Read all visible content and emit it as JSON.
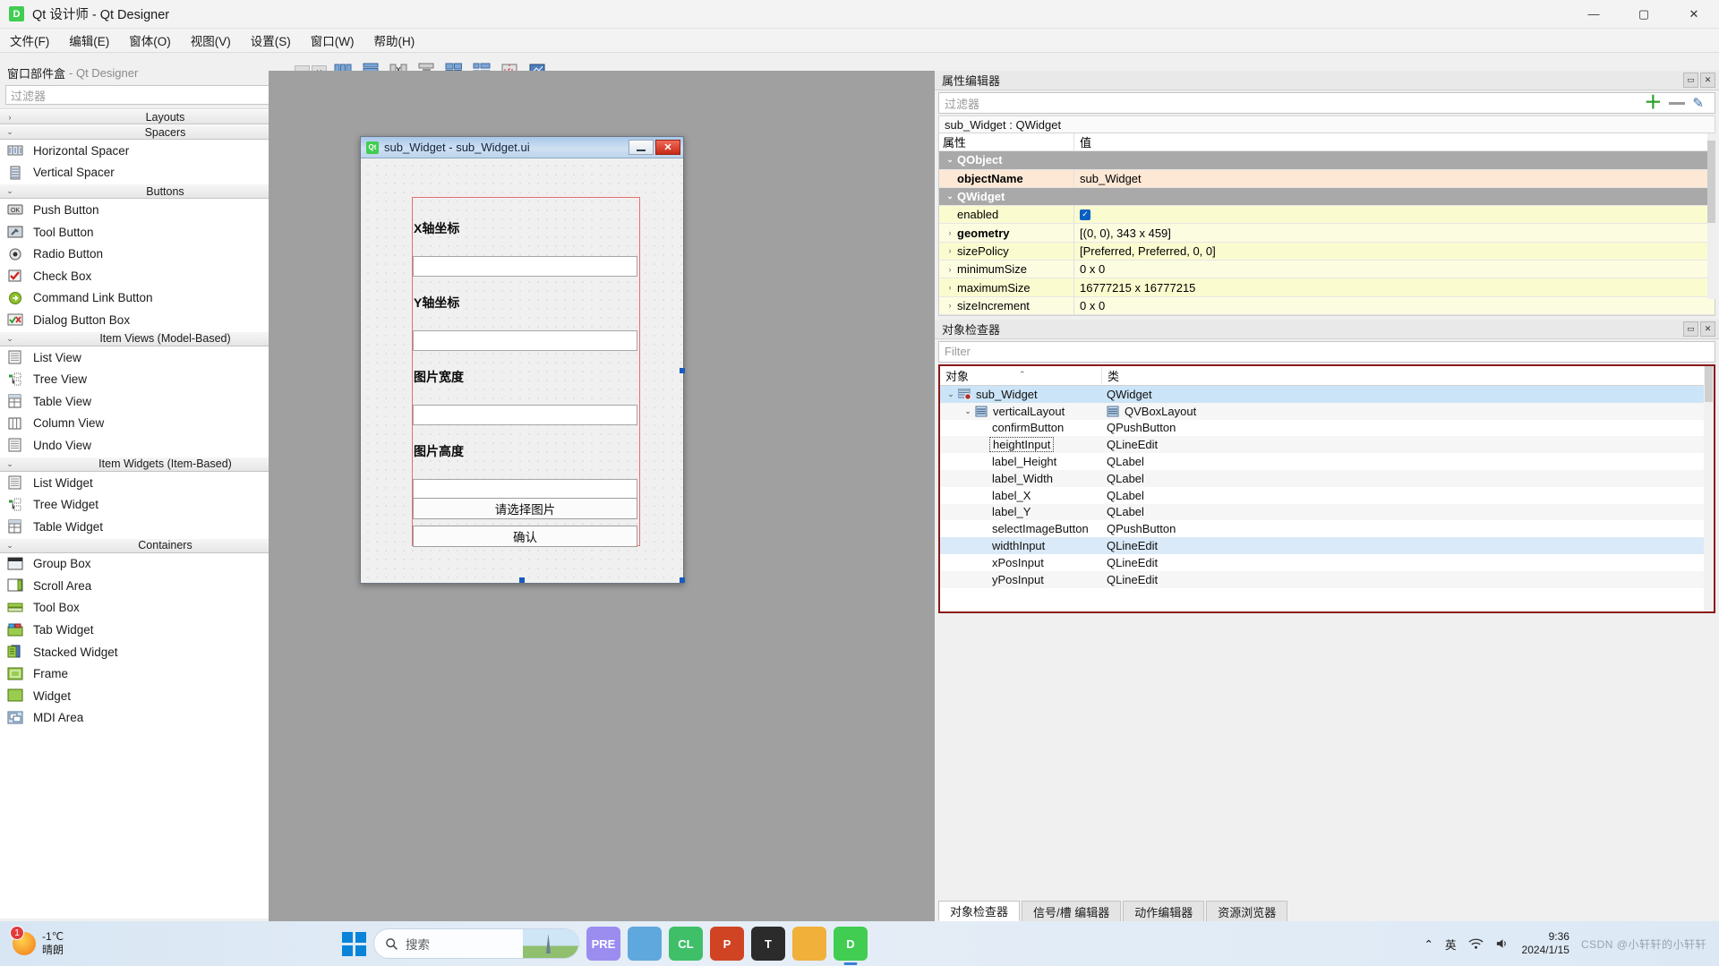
{
  "window": {
    "title": "Qt 设计师 - Qt Designer",
    "logo_text": "D",
    "minimize": "—",
    "maximize": "▢",
    "close": "✕"
  },
  "menubar": {
    "items": [
      "文件(F)",
      "编辑(E)",
      "窗体(O)",
      "视图(V)",
      "设置(S)",
      "窗口(W)",
      "帮助(H)"
    ]
  },
  "toolbar": {
    "icons": [
      "layout-horizontal-icon",
      "layout-vertical-icon",
      "layout-splitter-h-icon",
      "layout-splitter-v-icon",
      "layout-grid-icon",
      "layout-form-icon",
      "break-layout-icon",
      "adjust-size-icon"
    ]
  },
  "widgetbox": {
    "dock_title": "窗口部件盒",
    "dock_subtitle": "- Qt Designer",
    "dock_float": "▭",
    "dock_close": "✕",
    "filter_placeholder": "过滤器",
    "categories": [
      {
        "name": "Layouts",
        "expanded": false,
        "items": []
      },
      {
        "name": "Spacers",
        "expanded": true,
        "items": [
          {
            "label": "Horizontal Spacer",
            "icon": "horizontal-spacer-icon"
          },
          {
            "label": "Vertical Spacer",
            "icon": "vertical-spacer-icon"
          }
        ]
      },
      {
        "name": "Buttons",
        "expanded": true,
        "items": [
          {
            "label": "Push Button",
            "icon": "push-button-icon"
          },
          {
            "label": "Tool Button",
            "icon": "tool-button-icon"
          },
          {
            "label": "Radio Button",
            "icon": "radio-button-icon"
          },
          {
            "label": "Check Box",
            "icon": "check-box-icon"
          },
          {
            "label": "Command Link Button",
            "icon": "command-link-button-icon"
          },
          {
            "label": "Dialog Button Box",
            "icon": "dialog-button-box-icon"
          }
        ]
      },
      {
        "name": "Item Views (Model-Based)",
        "expanded": true,
        "items": [
          {
            "label": "List View",
            "icon": "list-view-icon"
          },
          {
            "label": "Tree View",
            "icon": "tree-view-icon"
          },
          {
            "label": "Table View",
            "icon": "table-view-icon"
          },
          {
            "label": "Column View",
            "icon": "column-view-icon"
          },
          {
            "label": "Undo View",
            "icon": "undo-view-icon"
          }
        ]
      },
      {
        "name": "Item Widgets (Item-Based)",
        "expanded": true,
        "items": [
          {
            "label": "List Widget",
            "icon": "list-widget-icon"
          },
          {
            "label": "Tree Widget",
            "icon": "tree-widget-icon"
          },
          {
            "label": "Table Widget",
            "icon": "table-widget-icon"
          }
        ]
      },
      {
        "name": "Containers",
        "expanded": true,
        "items": [
          {
            "label": "Group Box",
            "icon": "group-box-icon"
          },
          {
            "label": "Scroll Area",
            "icon": "scroll-area-icon"
          },
          {
            "label": "Tool Box",
            "icon": "tool-box-icon"
          },
          {
            "label": "Tab Widget",
            "icon": "tab-widget-icon"
          },
          {
            "label": "Stacked Widget",
            "icon": "stacked-widget-icon"
          },
          {
            "label": "Frame",
            "icon": "frame-icon"
          },
          {
            "label": "Widget",
            "icon": "widget-icon"
          },
          {
            "label": "MDI Area",
            "icon": "mdi-area-icon"
          }
        ]
      }
    ]
  },
  "form": {
    "title": "sub_Widget - sub_Widget.ui",
    "logo_text": "Qt",
    "minimize": "—",
    "close": "✕",
    "fields": [
      {
        "label": "X轴坐标",
        "input_value": ""
      },
      {
        "label": "Y轴坐标",
        "input_value": ""
      },
      {
        "label": "图片宽度",
        "input_value": ""
      },
      {
        "label": "图片高度",
        "input_value": ""
      }
    ],
    "buttons": [
      "请选择图片",
      "确认"
    ]
  },
  "property_editor": {
    "title": "属性编辑器",
    "float_btn": "▭",
    "close_btn": "✕",
    "filter_placeholder": "过滤器",
    "add_btn": "＋",
    "remove_btn": "▬",
    "config_btn": "🖉",
    "object_header": "sub_Widget : QWidget",
    "columns": [
      "属性",
      "值"
    ],
    "rows": [
      {
        "kind": "group",
        "name": "QObject",
        "value": "",
        "twisty": "⌄"
      },
      {
        "kind": "orange",
        "name": "objectName",
        "value": "sub_Widget",
        "bold": true,
        "twisty": ""
      },
      {
        "kind": "group",
        "name": "QWidget",
        "value": "",
        "twisty": "⌄"
      },
      {
        "kind": "yellow",
        "name": "enabled",
        "value": "checkbox",
        "twisty": ""
      },
      {
        "kind": "yellow2",
        "name": "geometry",
        "value": "[(0, 0), 343 x 459]",
        "bold": true,
        "twisty": "›"
      },
      {
        "kind": "yellow",
        "name": "sizePolicy",
        "value": "[Preferred, Preferred, 0, 0]",
        "twisty": "›"
      },
      {
        "kind": "yellow2",
        "name": "minimumSize",
        "value": "0 x 0",
        "twisty": "›"
      },
      {
        "kind": "yellow",
        "name": "maximumSize",
        "value": "16777215 x 16777215",
        "twisty": "›"
      },
      {
        "kind": "yellow2",
        "name": "sizeIncrement",
        "value": "0 x 0",
        "twisty": "›"
      }
    ]
  },
  "object_inspector": {
    "title": "对象检查器",
    "float_btn": "▭",
    "close_btn": "✕",
    "filter_placeholder": "Filter",
    "columns": [
      "对象",
      "类"
    ],
    "sort_arrow": "⌃",
    "rows": [
      {
        "name": "sub_Widget",
        "class": "QWidget",
        "indent": 0,
        "twisty": "⌄",
        "icon": "widget-icon",
        "selected": true,
        "class_icon": false
      },
      {
        "name": "verticalLayout",
        "class": "QVBoxLayout",
        "indent": 1,
        "twisty": "⌄",
        "icon": "layout-icon",
        "alt": true,
        "class_icon": true
      },
      {
        "name": "confirmButton",
        "class": "QPushButton",
        "indent": 2,
        "twisty": "",
        "icon": "",
        "class_icon": false
      },
      {
        "name": "heightInput",
        "class": "QLineEdit",
        "indent": 2,
        "twisty": "",
        "icon": "",
        "alt": true,
        "focus": true,
        "class_icon": false
      },
      {
        "name": "label_Height",
        "class": "QLabel",
        "indent": 2,
        "twisty": "",
        "icon": "",
        "class_icon": false
      },
      {
        "name": "label_Width",
        "class": "QLabel",
        "indent": 2,
        "twisty": "",
        "icon": "",
        "alt": true,
        "class_icon": false
      },
      {
        "name": "label_X",
        "class": "QLabel",
        "indent": 2,
        "twisty": "",
        "icon": "",
        "class_icon": false
      },
      {
        "name": "label_Y",
        "class": "QLabel",
        "indent": 2,
        "twisty": "",
        "icon": "",
        "alt": true,
        "class_icon": false
      },
      {
        "name": "selectImageButton",
        "class": "QPushButton",
        "indent": 2,
        "twisty": "",
        "icon": "",
        "class_icon": false
      },
      {
        "name": "widthInput",
        "class": "QLineEdit",
        "indent": 2,
        "twisty": "",
        "icon": "",
        "hl": true,
        "class_icon": false
      },
      {
        "name": "xPosInput",
        "class": "QLineEdit",
        "indent": 2,
        "twisty": "",
        "icon": "",
        "class_icon": false
      },
      {
        "name": "yPosInput",
        "class": "QLineEdit",
        "indent": 2,
        "twisty": "",
        "icon": "",
        "alt": true,
        "class_icon": false
      }
    ]
  },
  "bottom_tabs": {
    "items": [
      {
        "label": "对象检查器",
        "active": true
      },
      {
        "label": "信号/槽 编辑器",
        "active": false
      },
      {
        "label": "动作编辑器",
        "active": false
      },
      {
        "label": "资源浏览器",
        "active": false
      }
    ]
  },
  "taskbar": {
    "weather_temp": "-1℃",
    "weather_desc": "晴朗",
    "weather_badge": "1",
    "search_placeholder": "搜索",
    "search_icon": "search-icon",
    "apps": [
      {
        "name": "premiere-icon",
        "label": "PRE",
        "color": "#9b8df0",
        "active": false
      },
      {
        "name": "explorer2-icon",
        "label": "",
        "color": "#5fa8dd",
        "active": false
      },
      {
        "name": "clion-icon",
        "label": "CL",
        "color": "#3fbf68",
        "active": false
      },
      {
        "name": "powerpoint-icon",
        "label": "P",
        "color": "#d04423",
        "active": false
      },
      {
        "name": "typora-icon",
        "label": "T",
        "color": "#2b2b2b",
        "active": false
      },
      {
        "name": "file-explorer-icon",
        "label": "",
        "color": "#f0b03a",
        "active": false
      },
      {
        "name": "qt-designer-icon",
        "label": "D",
        "color": "#41cd52",
        "active": true
      }
    ],
    "tray": {
      "chevron": "⌃",
      "ime": "英",
      "network_icon": "network-icon",
      "volume_icon": "volume-icon",
      "time": "9:36",
      "date": "2024/1/15",
      "watermark": "CSDN @小轩轩的小轩轩"
    }
  }
}
